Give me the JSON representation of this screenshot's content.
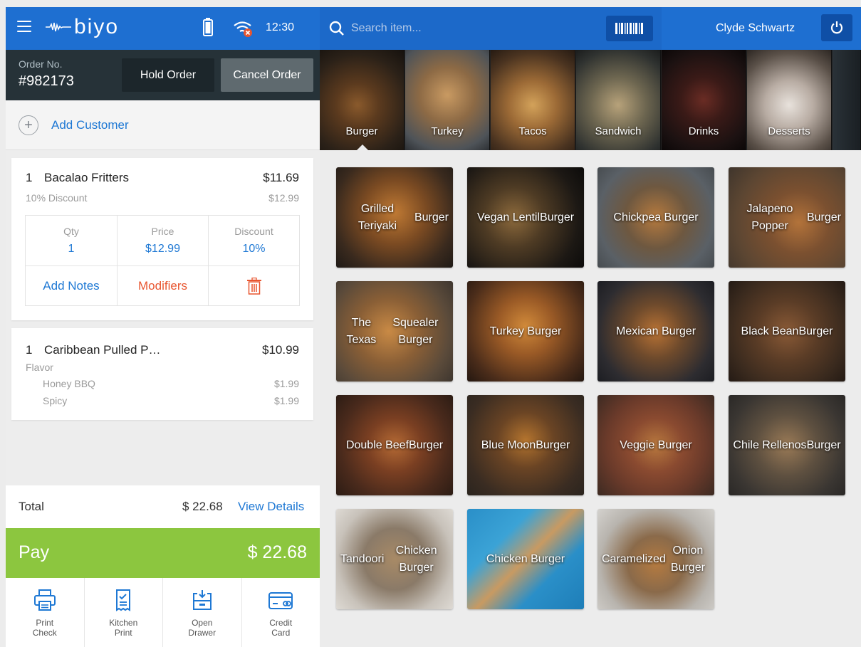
{
  "header": {
    "brand": "biyo",
    "time": "12:30",
    "colors": {
      "primary": "#1e6fd1",
      "dark": "#263238",
      "pay": "#8cc63f",
      "danger": "#e8552f",
      "link": "#1e78d4"
    }
  },
  "order": {
    "label": "Order No.",
    "number": "#982173",
    "hold_label": "Hold Order",
    "cancel_label": "Cancel Order"
  },
  "customer": {
    "add_label": "Add Customer"
  },
  "items": [
    {
      "qty": "1",
      "name": "Bacalao Fritters",
      "total": "$11.69",
      "discount_label": "10% Discount",
      "original_price": "$12.99",
      "detail": {
        "qty_label": "Qty",
        "qty_value": "1",
        "price_label": "Price",
        "price_value": "$12.99",
        "discount_label": "Discount",
        "discount_value": "10%",
        "notes_label": "Add Notes",
        "modifiers_label": "Modifiers"
      }
    },
    {
      "qty": "1",
      "name": "Caribbean Pulled P…",
      "total": "$10.99",
      "group_label": "Flavor",
      "modifiers": [
        {
          "name": "Honey BBQ",
          "price": "$1.99"
        },
        {
          "name": "Spicy",
          "price": "$1.99"
        }
      ]
    }
  ],
  "totals": {
    "label": "Total",
    "value": "$ 22.68",
    "details_label": "View Details"
  },
  "pay": {
    "label": "Pay",
    "amount": "$ 22.68"
  },
  "actions": [
    {
      "line1": "Print",
      "line2": "Check",
      "icon": "printer-icon"
    },
    {
      "line1": "Kitchen",
      "line2": "Print",
      "icon": "receipt-icon"
    },
    {
      "line1": "Open",
      "line2": "Drawer",
      "icon": "drawer-icon"
    },
    {
      "line1": "Credit",
      "line2": "Card",
      "icon": "credit-card-icon"
    }
  ],
  "search": {
    "placeholder": "Search item..."
  },
  "user": {
    "name": "Clyde Schwartz"
  },
  "categories": [
    "Burger",
    "Turkey",
    "Tacos",
    "Sandwich",
    "Drinks",
    "Desserts"
  ],
  "products": [
    [
      "Grilled Teriyaki",
      "Burger"
    ],
    [
      "Vegan Lentil",
      "Burger"
    ],
    [
      "Chickpea Burger"
    ],
    [
      "Jalapeno Popper",
      "Burger"
    ],
    [
      "The Texas",
      "Squealer Burger"
    ],
    [
      "Turkey Burger"
    ],
    [
      "Mexican Burger"
    ],
    [
      "Black Bean",
      "Burger"
    ],
    [
      "Double Beef",
      "Burger"
    ],
    [
      "Blue Moon",
      "Burger"
    ],
    [
      "Veggie Burger"
    ],
    [
      "Chile Rellenos",
      "Burger"
    ],
    [
      "Tandoori",
      "Chicken Burger"
    ],
    [
      "Chicken Burger"
    ],
    [
      "Caramelized",
      "Onion Burger"
    ]
  ]
}
